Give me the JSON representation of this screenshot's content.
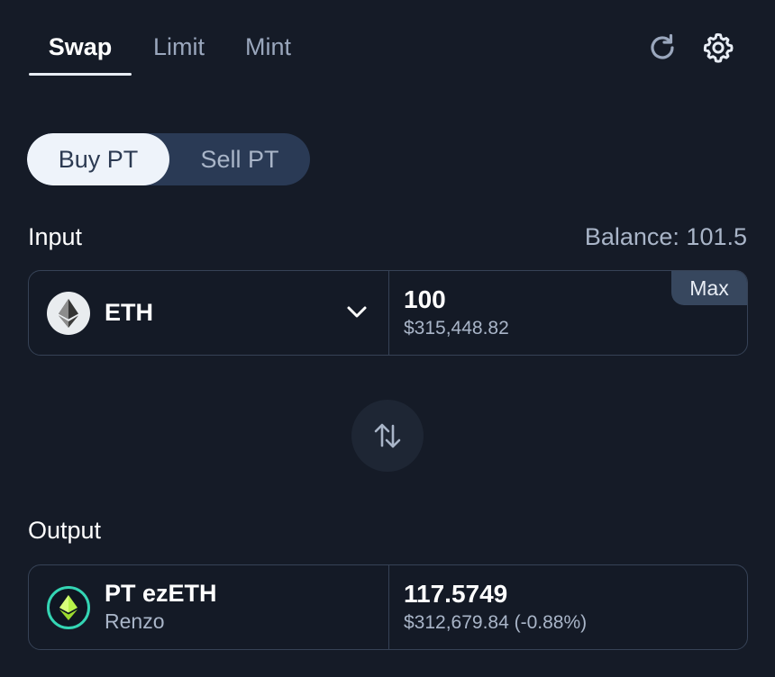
{
  "tabs": [
    {
      "label": "Swap",
      "active": true
    },
    {
      "label": "Limit",
      "active": false
    },
    {
      "label": "Mint",
      "active": false
    }
  ],
  "icons": {
    "refresh": "refresh-icon",
    "settings": "gear-icon",
    "swap": "swap-arrows-icon",
    "chevron": "chevron-down-icon"
  },
  "toggle": {
    "buy": "Buy PT",
    "sell": "Sell PT",
    "selected": "Buy PT"
  },
  "input": {
    "label": "Input",
    "balance": "Balance: 101.5",
    "token": "ETH",
    "amount": "100",
    "usd": "$315,448.82",
    "max_label": "Max"
  },
  "output": {
    "label": "Output",
    "token": "PT ezETH",
    "protocol": "Renzo",
    "amount": "117.5749",
    "usd": "$312,679.84 (-0.88%)"
  },
  "colors": {
    "background": "#151b27",
    "accent": "#34d5b4",
    "muted": "#a9b5c8",
    "border": "#364256"
  }
}
